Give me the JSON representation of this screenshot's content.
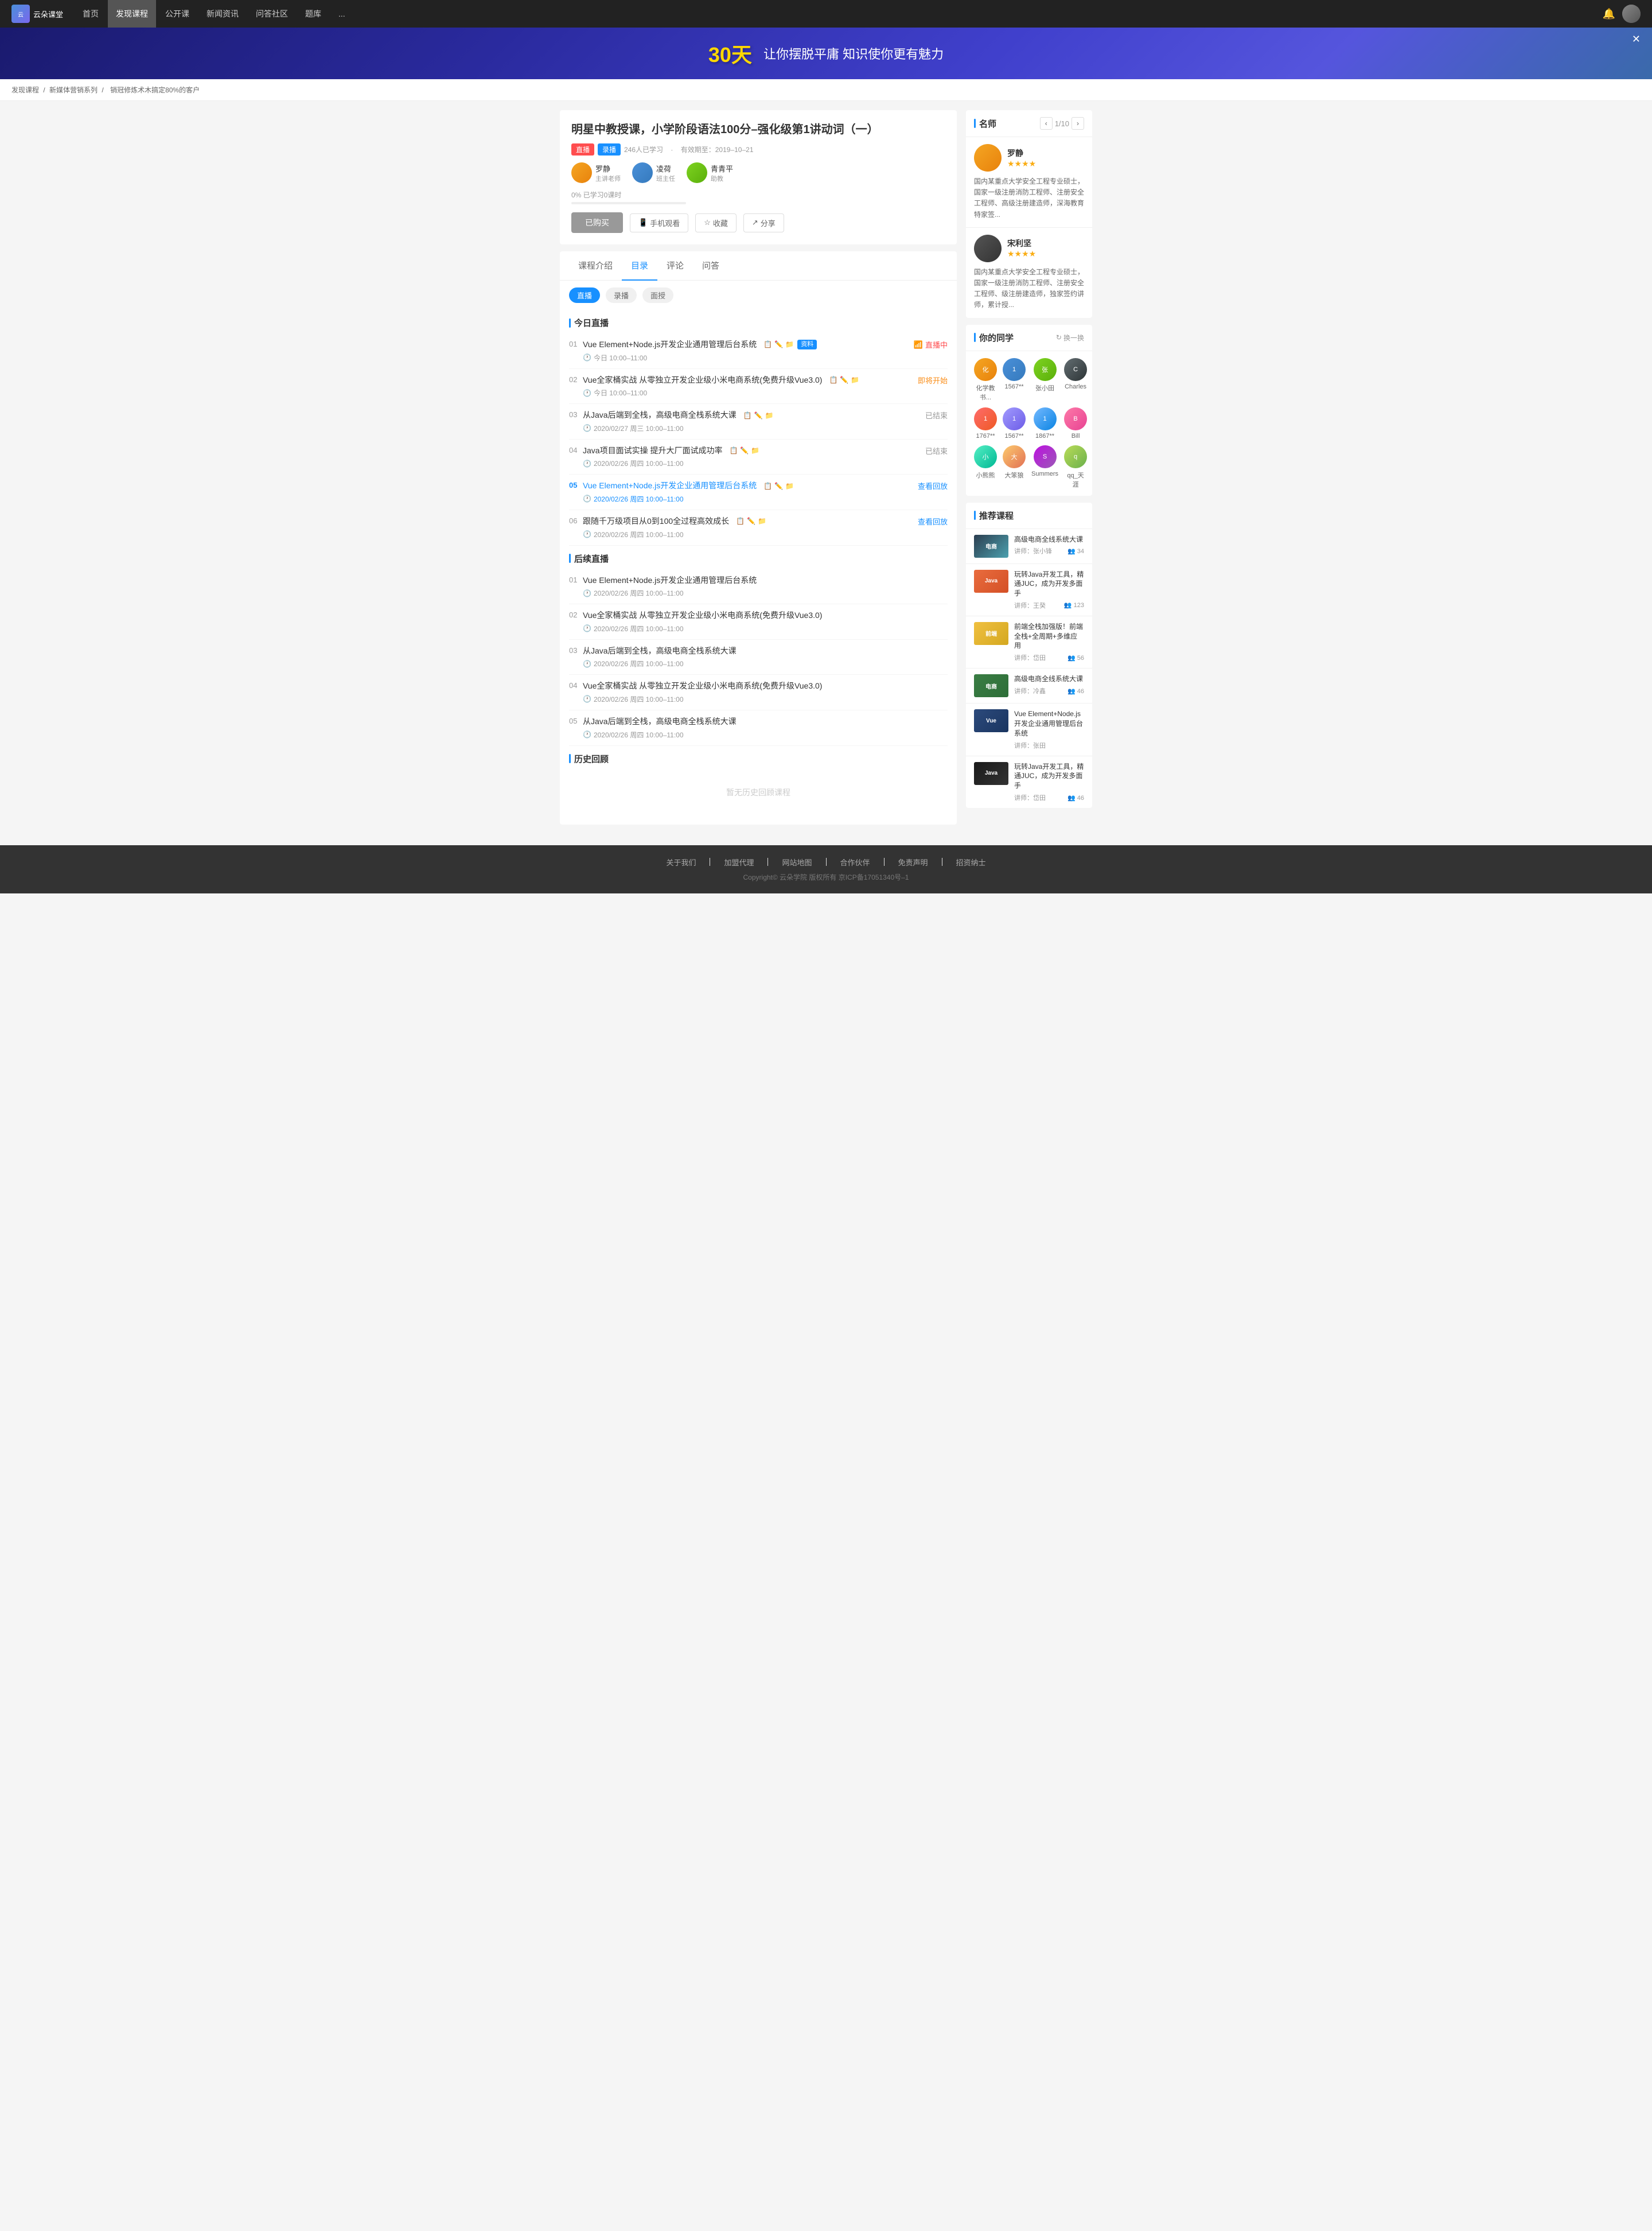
{
  "nav": {
    "logo_text": "云朵课堂",
    "items": [
      {
        "label": "首页",
        "active": false
      },
      {
        "label": "发现课程",
        "active": true
      },
      {
        "label": "公开课",
        "active": false
      },
      {
        "label": "新闻资讯",
        "active": false
      },
      {
        "label": "问答社区",
        "active": false
      },
      {
        "label": "题库",
        "active": false
      },
      {
        "label": "...",
        "active": false
      }
    ]
  },
  "banner": {
    "highlight": "30天",
    "text": "让你摆脱平庸 知识使你更有魅力",
    "close_label": "✕"
  },
  "breadcrumb": {
    "items": [
      "发现课程",
      "新媒体营销系列",
      "销冠修炼术木搞定80%的客户"
    ]
  },
  "course": {
    "title": "明星中教授课，小学阶段语法100分–强化级第1讲动词（一）",
    "tags": [
      "直播",
      "录播"
    ],
    "students": "246人已学习",
    "valid_until": "有效期至：2019–10–21",
    "progress_percent": 0,
    "progress_label": "0% 已学习0课时",
    "teachers": [
      {
        "name": "罗静",
        "role": "主讲老师"
      },
      {
        "name": "凌荷",
        "role": "班主任"
      },
      {
        "name": "青青平",
        "role": "助教"
      }
    ],
    "actions": {
      "buy_label": "已购买",
      "phone_label": "手机观看",
      "collect_label": "收藏",
      "share_label": "分享"
    }
  },
  "tabs": {
    "items": [
      "课程介绍",
      "目录",
      "评论",
      "问答"
    ],
    "active": "目录",
    "filters": [
      "直播",
      "录播",
      "面授"
    ],
    "active_filter": "直播"
  },
  "today_live": {
    "section_title": "今日直播",
    "lessons": [
      {
        "num": "01",
        "name": "Vue Element+Node.js开发企业通用管理后台系统",
        "icons": [
          "📋",
          "✏️",
          "📁"
        ],
        "material": "资料",
        "time": "今日 10:00–11:00",
        "status": "直播中",
        "status_type": "live"
      },
      {
        "num": "02",
        "name": "Vue全家桶实战 从零独立开发企业级小米电商系统(免费升级Vue3.0)",
        "icons": [
          "📋",
          "✏️",
          "📁"
        ],
        "time": "今日 10:00–11:00",
        "status": "即将开始",
        "status_type": "soon"
      },
      {
        "num": "03",
        "name": "从Java后端到全栈，高级电商全栈系统大课",
        "icons": [
          "📋",
          "✏️",
          "📁"
        ],
        "time": "2020/02/27 周三 10:00–11:00",
        "status": "已结束",
        "status_type": "ended"
      },
      {
        "num": "04",
        "name": "Java项目面试实操 提升大厂面试成功率",
        "icons": [
          "📋",
          "✏️",
          "📁"
        ],
        "time": "2020/02/26 周四 10:00–11:00",
        "status": "已结束",
        "status_type": "ended"
      },
      {
        "num": "05",
        "name": "Vue Element+Node.js开发企业通用管理后台系统",
        "icons": [
          "📋",
          "✏️",
          "📁"
        ],
        "time": "2020/02/26 周四 10:00–11:00",
        "status": "查看回放",
        "status_type": "replay",
        "active": true
      },
      {
        "num": "06",
        "name": "跟随千万级项目从0到100全过程高效成长",
        "icons": [
          "📋",
          "✏️",
          "📁"
        ],
        "time": "2020/02/26 周四 10:00–11:00",
        "status": "查看回放",
        "status_type": "replay"
      }
    ]
  },
  "upcoming_live": {
    "section_title": "后续直播",
    "lessons": [
      {
        "num": "01",
        "name": "Vue Element+Node.js开发企业通用管理后台系统",
        "time": "2020/02/26 周四 10:00–11:00"
      },
      {
        "num": "02",
        "name": "Vue全家桶实战 从零独立开发企业级小米电商系统(免费升级Vue3.0)",
        "time": "2020/02/26 周四 10:00–11:00"
      },
      {
        "num": "03",
        "name": "从Java后端到全栈，高级电商全栈系统大课",
        "time": "2020/02/26 周四 10:00–11:00"
      },
      {
        "num": "04",
        "name": "Vue全家桶实战 从零独立开发企业级小米电商系统(免费升级Vue3.0)",
        "time": "2020/02/26 周四 10:00–11:00"
      },
      {
        "num": "05",
        "name": "从Java后端到全栈，高级电商全栈系统大课",
        "time": "2020/02/26 周四 10:00–11:00"
      }
    ]
  },
  "history": {
    "section_title": "历史回顾",
    "empty_text": "暂无历史回顾课程"
  },
  "sidebar": {
    "teachers_section": {
      "title": "名师",
      "nav": "1/10",
      "teachers": [
        {
          "name": "罗静",
          "stars": "★★★★",
          "desc": "国内某重点大学安全工程专业硕士，国家一级注册消防工程师、注册安全工程师、高级注册建造师，深海教育特家签..."
        },
        {
          "name": "宋利坚",
          "stars": "★★★★",
          "desc": "国内某重点大学安全工程专业硕士，国家一级注册消防工程师、注册安全工程师、级注册建造师，独家签约讲师，累计授..."
        }
      ]
    },
    "classmates_section": {
      "title": "你的同学",
      "refresh_label": "换一换",
      "classmates": [
        {
          "name": "化学教书...",
          "color": "av1"
        },
        {
          "name": "1567**",
          "color": "av2"
        },
        {
          "name": "张小田",
          "color": "av3"
        },
        {
          "name": "Charles",
          "color": "av11"
        },
        {
          "name": "1767**",
          "color": "av5"
        },
        {
          "name": "1567**",
          "color": "av6"
        },
        {
          "name": "1867**",
          "color": "av10"
        },
        {
          "name": "Bill",
          "color": "av7"
        },
        {
          "name": "小熊熊",
          "color": "av8"
        },
        {
          "name": "大笨狼",
          "color": "av9"
        },
        {
          "name": "Summers",
          "color": "av4"
        },
        {
          "name": "qq_天涯",
          "color": "av12"
        }
      ]
    },
    "recommended": {
      "title": "推荐课程",
      "items": [
        {
          "thumb_class": "rec-thumb-1",
          "title": "高级电商全线系统大课",
          "lecturer": "讲师：张小锋",
          "students": "34",
          "thumb_text": "电商"
        },
        {
          "thumb_class": "rec-thumb-2",
          "title": "玩转Java开发工具，精通JUC，成为开发多面手",
          "lecturer": "讲师：王癸",
          "students": "123",
          "thumb_text": "Java"
        },
        {
          "thumb_class": "rec-thumb-3",
          "title": "前端全栈加强版！前端全栈+全周期+多维应用",
          "lecturer": "讲师：岱田",
          "students": "56",
          "thumb_text": "前端"
        },
        {
          "thumb_class": "rec-thumb-4",
          "title": "高级电商全线系统大课",
          "lecturer": "讲师：冷鑫",
          "students": "46",
          "thumb_text": "电商"
        },
        {
          "thumb_class": "rec-thumb-5",
          "title": "Vue Element+Node.js开发企业通用管理后台系统",
          "lecturer": "讲师：张田",
          "students": "",
          "thumb_text": "Vue"
        },
        {
          "thumb_class": "rec-thumb-6",
          "title": "玩转Java开发工具，精通JUC，成为开发多面手",
          "lecturer": "讲师：岱田",
          "students": "46",
          "thumb_text": "Java"
        }
      ]
    }
  },
  "footer": {
    "links": [
      "关于我们",
      "加盟代理",
      "网站地图",
      "合作伙伴",
      "免责声明",
      "招资纳士"
    ],
    "copyright": "Copyright© 云朵学院  版权所有  京ICP备17051340号–1"
  }
}
